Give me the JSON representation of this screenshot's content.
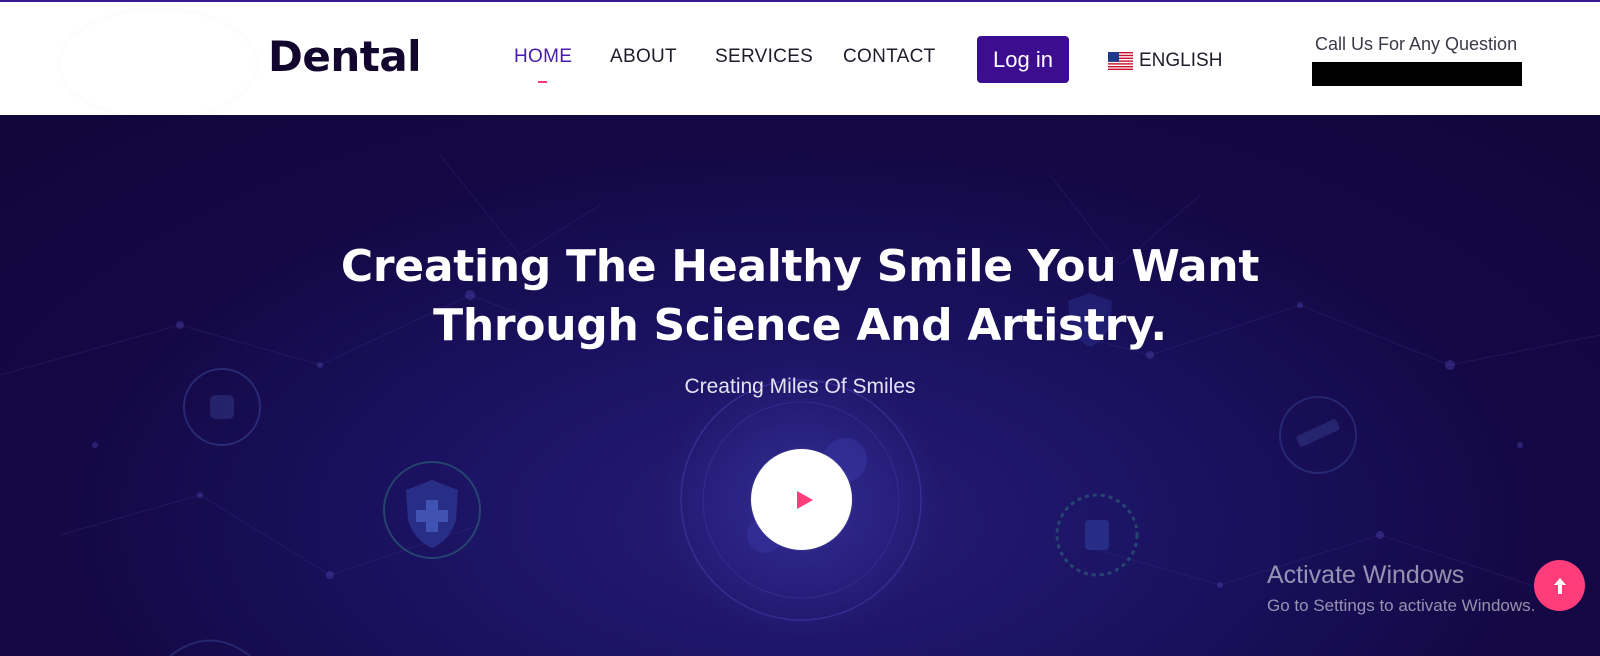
{
  "brand": {
    "name": "Dental"
  },
  "nav": {
    "items": [
      {
        "label": "HOME",
        "active": true
      },
      {
        "label": "ABOUT",
        "active": false
      },
      {
        "label": "SERVICES",
        "active": false
      },
      {
        "label": "CONTACT",
        "active": false
      }
    ],
    "login_label": "Log in",
    "language": {
      "label": "ENGLISH",
      "icon": "us-flag-icon"
    }
  },
  "contact": {
    "label": "Call Us For Any Question",
    "phone_redacted": true
  },
  "hero": {
    "title_line1": "Creating The Healthy Smile You Want",
    "title_line2": "Through Science And Artistry.",
    "subtitle": "Creating Miles Of Smiles",
    "play_icon": "play-icon"
  },
  "overlay": {
    "watermark_title": "Activate Windows",
    "watermark_sub": "Go to Settings to activate Windows.",
    "scroll_top_icon": "arrow-up-icon"
  },
  "colors": {
    "primary": "#3c0d8f",
    "accent": "#ff3d7b",
    "hero_bg": "#140845",
    "nav_active": "#4a1bb0"
  }
}
